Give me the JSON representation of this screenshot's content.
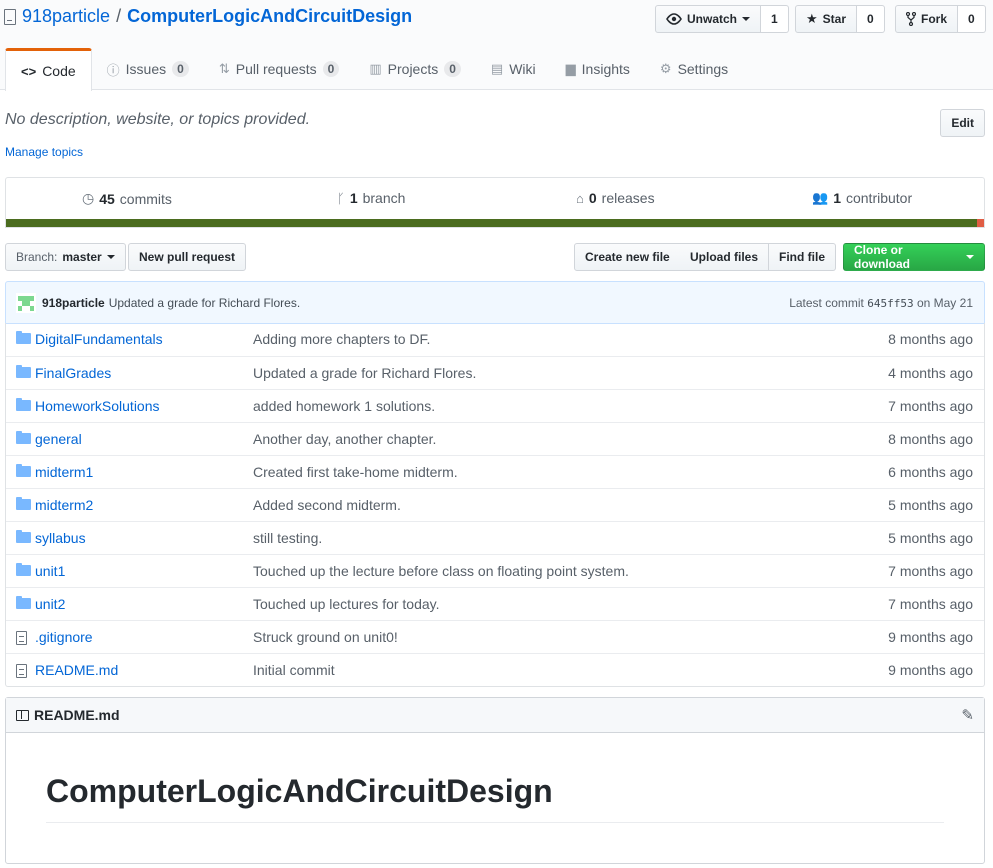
{
  "repo": {
    "owner": "918particle",
    "separator": "/",
    "name": "ComputerLogicAndCircuitDesign"
  },
  "actions": {
    "watch": {
      "label": "Unwatch",
      "count": "1"
    },
    "star": {
      "label": "Star",
      "count": "0"
    },
    "fork": {
      "label": "Fork",
      "count": "0"
    }
  },
  "tabs": [
    {
      "label": "Code",
      "icon": "code-icon"
    },
    {
      "label": "Issues",
      "icon": "issue-icon",
      "count": "0"
    },
    {
      "label": "Pull requests",
      "icon": "pull-request-icon",
      "count": "0"
    },
    {
      "label": "Projects",
      "icon": "project-icon",
      "count": "0"
    },
    {
      "label": "Wiki",
      "icon": "book-icon"
    },
    {
      "label": "Insights",
      "icon": "graph-icon"
    },
    {
      "label": "Settings",
      "icon": "gear-icon"
    }
  ],
  "description": "No description, website, or topics provided.",
  "manage_topics": "Manage topics",
  "edit_label": "Edit",
  "summary": {
    "commits": {
      "num": "45",
      "label": "commits"
    },
    "branch": {
      "num": "1",
      "label": "branch"
    },
    "releases": {
      "num": "0",
      "label": "releases"
    },
    "contributor": {
      "num": "1",
      "label": "contributor"
    }
  },
  "language_colors": {
    "primary": "#4b6c1f",
    "secondary": "#e05d44"
  },
  "file_nav": {
    "branch_prefix": "Branch:",
    "branch_name": "master",
    "new_pr": "New pull request",
    "create_file": "Create new file",
    "upload_files": "Upload files",
    "find_file": "Find file",
    "clone": "Clone or download"
  },
  "latest_commit": {
    "author": "918particle",
    "message": "Updated a grade for Richard Flores.",
    "prefix": "Latest commit",
    "sha": "645ff53",
    "date": "on May 21"
  },
  "files": [
    {
      "type": "dir",
      "name": "DigitalFundamentals",
      "message": "Adding more chapters to DF.",
      "age": "8 months ago"
    },
    {
      "type": "dir",
      "name": "FinalGrades",
      "message": "Updated a grade for Richard Flores.",
      "age": "4 months ago"
    },
    {
      "type": "dir",
      "name": "HomeworkSolutions",
      "message": "added homework 1 solutions.",
      "age": "7 months ago"
    },
    {
      "type": "dir",
      "name": "general",
      "message": "Another day, another chapter.",
      "age": "8 months ago"
    },
    {
      "type": "dir",
      "name": "midterm1",
      "message": "Created first take-home midterm.",
      "age": "6 months ago"
    },
    {
      "type": "dir",
      "name": "midterm2",
      "message": "Added second midterm.",
      "age": "5 months ago"
    },
    {
      "type": "dir",
      "name": "syllabus",
      "message": "still testing.",
      "age": "5 months ago"
    },
    {
      "type": "dir",
      "name": "unit1",
      "message": "Touched up the lecture before class on floating point system.",
      "age": "7 months ago"
    },
    {
      "type": "dir",
      "name": "unit2",
      "message": "Touched up lectures for today.",
      "age": "7 months ago"
    },
    {
      "type": "file",
      "name": ".gitignore",
      "message": "Struck ground on unit0!",
      "age": "9 months ago"
    },
    {
      "type": "file",
      "name": "README.md",
      "message": "Initial commit",
      "age": "9 months ago"
    }
  ],
  "readme": {
    "filename": "README.md",
    "heading": "ComputerLogicAndCircuitDesign"
  }
}
